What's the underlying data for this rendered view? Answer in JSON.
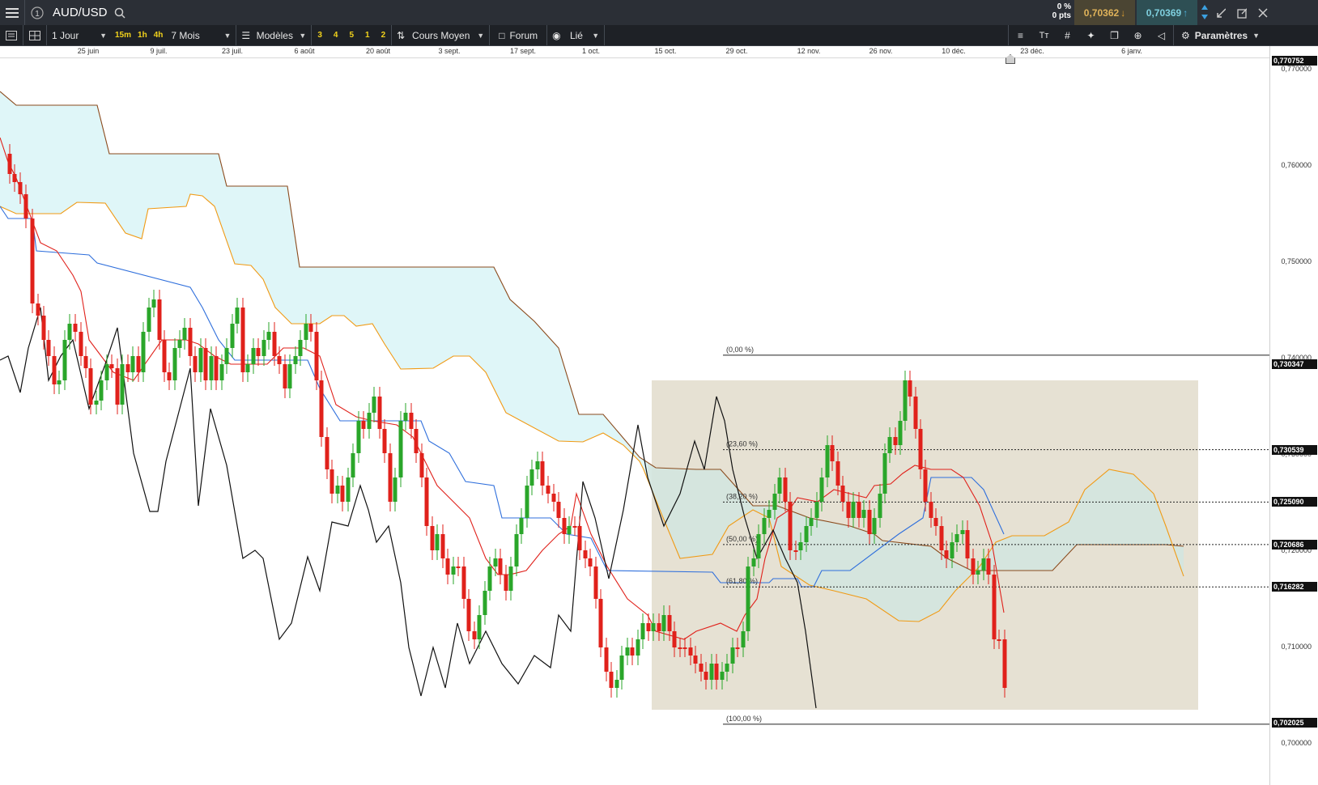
{
  "header": {
    "symbol": "AUD/USD",
    "change_pct": "0 %",
    "change_pts": "0 pts",
    "sell_price": "0,70362",
    "buy_price": "0,70369"
  },
  "toolbar": {
    "period": "1 Jour",
    "intervals": [
      "15m",
      "1h",
      "4h"
    ],
    "range": "7 Mois",
    "templates_label": "Modèles",
    "template_slots": [
      "3",
      "4",
      "5",
      "1",
      "2"
    ],
    "indicator_label": "Cours Moyen",
    "forum_label": "Forum",
    "linked_label": "Lié",
    "settings_label": "Paramètres"
  },
  "chart_data": {
    "type": "candlestick",
    "symbol": "AUD/USD",
    "x_ticks": [
      "25 juin",
      "9 juil.",
      "23 juil.",
      "6 août",
      "20 août",
      "3 sept.",
      "17 sept.",
      "1 oct.",
      "15 oct.",
      "29 oct.",
      "12 nov.",
      "26 nov.",
      "10 déc.",
      "23 déc.",
      "6 janv."
    ],
    "y_ticks": [
      "0,770000",
      "0,760000",
      "0,750000",
      "0,740000",
      "0,730000",
      "0,720000",
      "0,710000",
      "0,700000"
    ],
    "ylim": [
      0.6985,
      0.7715
    ],
    "price_labels": [
      {
        "value": 0.770752,
        "text": "0,770752",
        "style": "dark"
      },
      {
        "value": 0.730347,
        "text": "0,730347",
        "style": "dark"
      },
      {
        "value": 0.730539,
        "text": "0,730539",
        "style": "dark"
      },
      {
        "value": 0.72509,
        "text": "0,725090",
        "style": "dark"
      },
      {
        "value": 0.720686,
        "text": "0,720686",
        "style": "dark"
      },
      {
        "value": 0.716282,
        "text": "0,716282",
        "style": "dark"
      },
      {
        "value": 0.702025,
        "text": "0,702025",
        "style": "dark"
      }
    ],
    "fibonacci": {
      "high": 0.740347,
      "low": 0.702025,
      "levels": [
        {
          "label": "(0,00 %)",
          "value": 0.740347
        },
        {
          "label": "(23,60 %)",
          "value": 0.730539
        },
        {
          "label": "(38,20 %)",
          "value": 0.72509
        },
        {
          "label": "(50,00 %)",
          "value": 0.720686
        },
        {
          "label": "(61,80 %)",
          "value": 0.716282
        },
        {
          "label": "(100,00 %)",
          "value": 0.702025
        }
      ]
    },
    "series": [
      {
        "name": "",
        "color": "#e0211b",
        "role": "tenkan"
      },
      {
        "name": "",
        "color": "#2f6fdc",
        "role": "kijun"
      },
      {
        "name": "",
        "color": "#f09a14",
        "role": "senkou-a"
      },
      {
        "name": "",
        "color": "#8a4a1c",
        "role": "senkou-b"
      },
      {
        "name": "",
        "color": "#111111",
        "role": "chikou"
      }
    ],
    "candle_colors": {
      "up": "#2aa62a",
      "down": "#e0211b"
    },
    "cloud_colors": {
      "bullish": "#dff6f8",
      "bearish": "#d3e6df"
    },
    "highlight_box_color": "#e6e1d3",
    "grid": false
  }
}
